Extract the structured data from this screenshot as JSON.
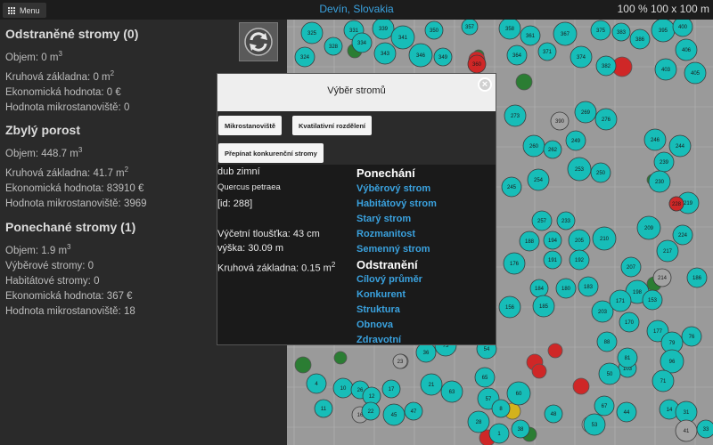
{
  "topbar": {
    "menu_label": "Menu",
    "location": "Devín, Slovakia",
    "scale": "100 % 100 x 100 m"
  },
  "removed": {
    "title": "Odstraněné stromy (0)",
    "volume": "Objem: 0 m",
    "volume_unit_sup": "3",
    "basal_area": "Kruhová základna: 0 m",
    "basal_area_sup": "2",
    "economic_value": "Ekonomická hodnota: 0 €",
    "microhabitat_value": "Hodnota mikrostanoviště: 0"
  },
  "remaining": {
    "title": "Zbylý porost",
    "volume": "Objem: 448.7 m",
    "volume_unit_sup": "3",
    "basal_area": "Kruhová základna: 41.7 m",
    "basal_area_sup": "2",
    "economic_value": "Ekonomická hodnota: 83910 €",
    "microhabitat_value": "Hodnota mikrostanoviště: 3969"
  },
  "retained": {
    "title": "Ponechané stromy (1)",
    "volume": "Objem: 1.9 m",
    "volume_unit_sup": "3",
    "selection_trees": "Výběrové stromy: 0",
    "habitat_trees": "Habitátové stromy: 0",
    "economic_value": "Ekonomická hodnota: 367 €",
    "microhabitat_value": "Hodnota mikrostanoviště: 18"
  },
  "dialog": {
    "title": "Výběr stromů",
    "buttons": {
      "microhabitats": "Mikrostanoviště",
      "quality": "Kvatilativní rozdělení",
      "competition": "Přepínat konkurenční stromy"
    },
    "tree": {
      "common_name": "dub zimní",
      "latin_name": "Quercus petraea",
      "id": "[id: 288]",
      "dbh": "Výčetní tloušťka: 43 cm",
      "height": "výška: 30.09 m",
      "basal_area": "Kruhová základna: 0.15 m",
      "basal_area_sup": "2"
    },
    "retain_group": "Ponechání",
    "retain_actions": [
      "Výběrový strom",
      "Habitátový strom",
      "Starý strom",
      "Rozmanitost",
      "Semenný strom"
    ],
    "remove_group": "Odstranění",
    "remove_actions": [
      "Cílový průměr",
      "Konkurent",
      "Struktura",
      "Obnova",
      "Zdravotní"
    ]
  },
  "map_trees": [
    {
      "id": "325",
      "type": "teal"
    },
    {
      "id": "331",
      "type": "teal"
    },
    {
      "id": "339",
      "type": "teal"
    },
    {
      "id": "341",
      "type": "teal"
    },
    {
      "id": "350",
      "type": "teal"
    },
    {
      "id": "357",
      "type": "teal"
    },
    {
      "id": "358",
      "type": "teal"
    },
    {
      "id": "361",
      "type": "teal"
    },
    {
      "id": "367",
      "type": "teal"
    },
    {
      "id": "375",
      "type": "teal"
    },
    {
      "id": "383",
      "type": "teal"
    },
    {
      "id": "386",
      "type": "teal"
    },
    {
      "id": "395",
      "type": "teal"
    },
    {
      "id": "400",
      "type": "teal"
    },
    {
      "id": "406",
      "type": "teal"
    },
    {
      "id": "324",
      "type": "teal"
    },
    {
      "id": "328",
      "type": "teal"
    },
    {
      "id": "334",
      "type": "teal"
    },
    {
      "id": "343",
      "type": "teal"
    },
    {
      "id": "346",
      "type": "teal"
    },
    {
      "id": "349",
      "type": "teal"
    },
    {
      "id": "360",
      "type": "red"
    },
    {
      "id": "364",
      "type": "teal"
    },
    {
      "id": "371",
      "type": "teal"
    },
    {
      "id": "374",
      "type": "teal"
    },
    {
      "id": "382",
      "type": "teal"
    },
    {
      "id": "403",
      "type": "teal"
    },
    {
      "id": "405",
      "type": "teal"
    },
    {
      "id": "273",
      "type": "teal"
    },
    {
      "id": "390",
      "type": "gray"
    },
    {
      "id": "269",
      "type": "teal"
    },
    {
      "id": "276",
      "type": "teal"
    },
    {
      "id": "260",
      "type": "teal"
    },
    {
      "id": "249",
      "type": "teal"
    },
    {
      "id": "262",
      "type": "teal"
    },
    {
      "id": "246",
      "type": "teal"
    },
    {
      "id": "244",
      "type": "teal"
    },
    {
      "id": "253",
      "type": "teal"
    },
    {
      "id": "239",
      "type": "teal"
    },
    {
      "id": "250",
      "type": "teal"
    },
    {
      "id": "230",
      "type": "teal"
    },
    {
      "id": "245",
      "type": "teal"
    },
    {
      "id": "254",
      "type": "teal"
    },
    {
      "id": "219",
      "type": "teal"
    },
    {
      "id": "228",
      "type": "red"
    },
    {
      "id": "257",
      "type": "teal"
    },
    {
      "id": "233",
      "type": "teal"
    },
    {
      "id": "209",
      "type": "teal"
    },
    {
      "id": "224",
      "type": "teal"
    },
    {
      "id": "188",
      "type": "teal"
    },
    {
      "id": "194",
      "type": "teal"
    },
    {
      "id": "205",
      "type": "teal"
    },
    {
      "id": "210",
      "type": "teal"
    },
    {
      "id": "217",
      "type": "teal"
    },
    {
      "id": "191",
      "type": "teal"
    },
    {
      "id": "192",
      "type": "teal"
    },
    {
      "id": "207",
      "type": "teal"
    },
    {
      "id": "214",
      "type": "gray"
    },
    {
      "id": "186",
      "type": "teal"
    },
    {
      "id": "176",
      "type": "teal"
    },
    {
      "id": "184",
      "type": "teal"
    },
    {
      "id": "180",
      "type": "teal"
    },
    {
      "id": "203",
      "type": "teal"
    },
    {
      "id": "185",
      "type": "teal"
    },
    {
      "id": "183",
      "type": "teal"
    },
    {
      "id": "198",
      "type": "teal"
    },
    {
      "id": "171",
      "type": "teal"
    },
    {
      "id": "153",
      "type": "teal"
    },
    {
      "id": "156",
      "type": "teal"
    },
    {
      "id": "170",
      "type": "teal"
    },
    {
      "id": "177",
      "type": "teal"
    },
    {
      "id": "88",
      "type": "teal"
    },
    {
      "id": "79",
      "type": "teal"
    },
    {
      "id": "76",
      "type": "teal"
    },
    {
      "id": "96",
      "type": "teal"
    },
    {
      "id": "103",
      "type": "teal"
    },
    {
      "id": "81",
      "type": "teal"
    },
    {
      "id": "71",
      "type": "teal"
    },
    {
      "id": "36",
      "type": "teal"
    },
    {
      "id": "73",
      "type": "teal"
    },
    {
      "id": "23",
      "type": "gray"
    },
    {
      "id": "54",
      "type": "teal"
    },
    {
      "id": "4",
      "type": "teal"
    },
    {
      "id": "10",
      "type": "teal"
    },
    {
      "id": "26",
      "type": "teal"
    },
    {
      "id": "12",
      "type": "teal"
    },
    {
      "id": "17",
      "type": "teal"
    },
    {
      "id": "21",
      "type": "teal"
    },
    {
      "id": "63",
      "type": "teal"
    },
    {
      "id": "65",
      "type": "teal"
    },
    {
      "id": "60",
      "type": "teal"
    },
    {
      "id": "50",
      "type": "teal"
    },
    {
      "id": "11",
      "type": "teal"
    },
    {
      "id": "16",
      "type": "gray"
    },
    {
      "id": "22",
      "type": "teal"
    },
    {
      "id": "45",
      "type": "teal"
    },
    {
      "id": "47",
      "type": "teal"
    },
    {
      "id": "57",
      "type": "teal"
    },
    {
      "id": "67",
      "type": "teal"
    },
    {
      "id": "53",
      "type": "teal"
    },
    {
      "id": "48",
      "type": "teal"
    },
    {
      "id": "8",
      "type": "teal"
    },
    {
      "id": "1",
      "type": "teal"
    },
    {
      "id": "28",
      "type": "teal"
    },
    {
      "id": "38",
      "type": "teal"
    },
    {
      "id": "44",
      "type": "teal"
    },
    {
      "id": "14",
      "type": "teal"
    },
    {
      "id": "31",
      "type": "teal"
    },
    {
      "id": "41",
      "type": "gray"
    },
    {
      "id": "33",
      "type": "teal"
    }
  ],
  "colors": {
    "teal": "#16bdb8",
    "red": "#d42a2a",
    "green": "#2e7d32",
    "gray": "#9a9a9a",
    "yellow": "#d4b11a",
    "accent": "#3aa2df"
  }
}
